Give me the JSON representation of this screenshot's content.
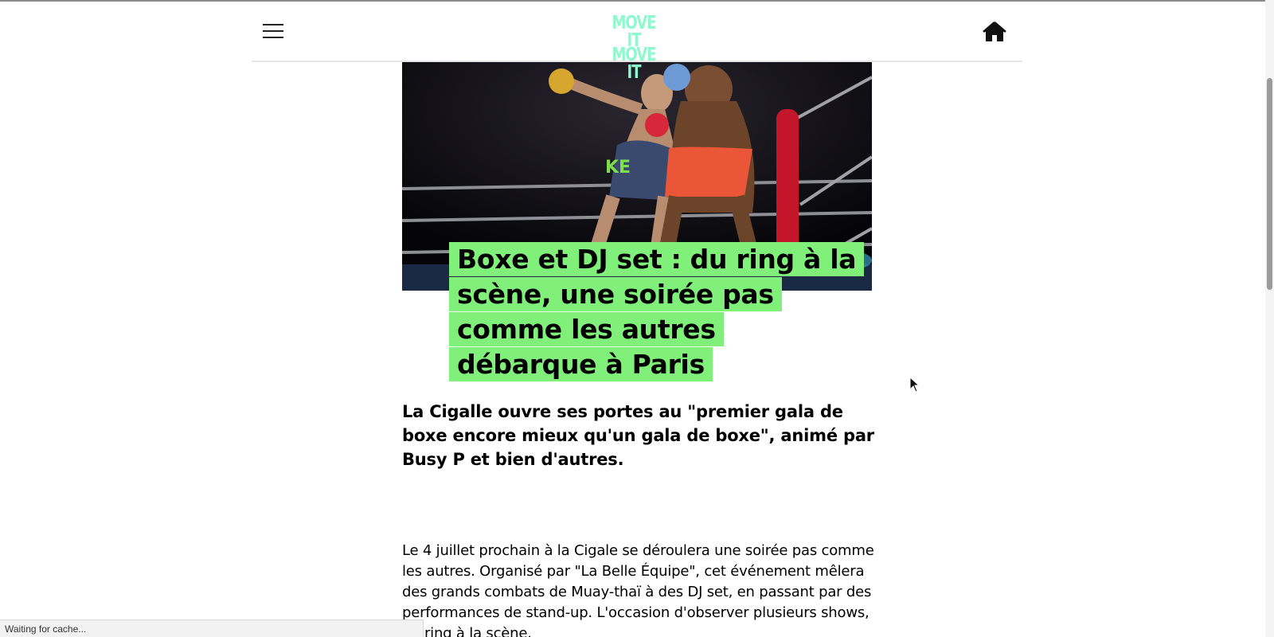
{
  "header": {
    "menu_icon": "hamburger-menu-icon",
    "logo_lines": [
      "MOVE IT",
      "MOVE IT"
    ],
    "home_icon": "home-icon"
  },
  "article": {
    "hero_image": "boxing-ring-photo",
    "title": "Boxe et DJ set : du ring à la scène, une soirée pas comme les autres débarque à Paris",
    "title_highlight_color": "#80f07a",
    "subtitle": "La Cigalle ouvre ses portes au \"premier gala de boxe encore mieux qu'un gala de boxe\", animé par Busy P et bien d'autres.",
    "body": "Le 4 juillet prochain à la Cigale se déroulera une soirée pas comme les autres. Organisé par \"La Belle Équipe\", cet événement mêlera des grands combats de Muay-thaï à des DJ set, en passant par des performances de stand-up. L'occasion d'observer plusieurs shows, du ring à la scène."
  },
  "status_bar": {
    "text": "Waiting for cache..."
  },
  "colors": {
    "accent_green": "#80f07a",
    "logo_mint": "#8ef9cf",
    "tag_red": "#ee1d24"
  }
}
